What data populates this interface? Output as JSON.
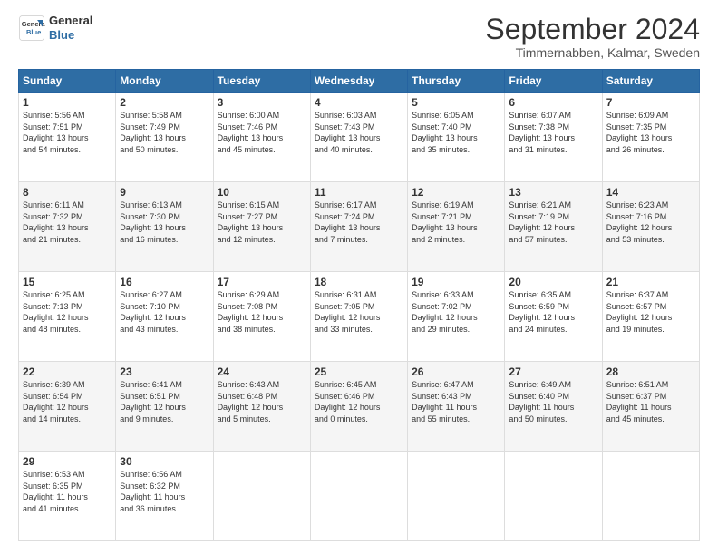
{
  "logo": {
    "line1": "General",
    "line2": "Blue"
  },
  "title": "September 2024",
  "subtitle": "Timmernabben, Kalmar, Sweden",
  "days_header": [
    "Sunday",
    "Monday",
    "Tuesday",
    "Wednesday",
    "Thursday",
    "Friday",
    "Saturday"
  ],
  "weeks": [
    [
      {
        "day": "1",
        "info": "Sunrise: 5:56 AM\nSunset: 7:51 PM\nDaylight: 13 hours\nand 54 minutes."
      },
      {
        "day": "2",
        "info": "Sunrise: 5:58 AM\nSunset: 7:49 PM\nDaylight: 13 hours\nand 50 minutes."
      },
      {
        "day": "3",
        "info": "Sunrise: 6:00 AM\nSunset: 7:46 PM\nDaylight: 13 hours\nand 45 minutes."
      },
      {
        "day": "4",
        "info": "Sunrise: 6:03 AM\nSunset: 7:43 PM\nDaylight: 13 hours\nand 40 minutes."
      },
      {
        "day": "5",
        "info": "Sunrise: 6:05 AM\nSunset: 7:40 PM\nDaylight: 13 hours\nand 35 minutes."
      },
      {
        "day": "6",
        "info": "Sunrise: 6:07 AM\nSunset: 7:38 PM\nDaylight: 13 hours\nand 31 minutes."
      },
      {
        "day": "7",
        "info": "Sunrise: 6:09 AM\nSunset: 7:35 PM\nDaylight: 13 hours\nand 26 minutes."
      }
    ],
    [
      {
        "day": "8",
        "info": "Sunrise: 6:11 AM\nSunset: 7:32 PM\nDaylight: 13 hours\nand 21 minutes."
      },
      {
        "day": "9",
        "info": "Sunrise: 6:13 AM\nSunset: 7:30 PM\nDaylight: 13 hours\nand 16 minutes."
      },
      {
        "day": "10",
        "info": "Sunrise: 6:15 AM\nSunset: 7:27 PM\nDaylight: 13 hours\nand 12 minutes."
      },
      {
        "day": "11",
        "info": "Sunrise: 6:17 AM\nSunset: 7:24 PM\nDaylight: 13 hours\nand 7 minutes."
      },
      {
        "day": "12",
        "info": "Sunrise: 6:19 AM\nSunset: 7:21 PM\nDaylight: 13 hours\nand 2 minutes."
      },
      {
        "day": "13",
        "info": "Sunrise: 6:21 AM\nSunset: 7:19 PM\nDaylight: 12 hours\nand 57 minutes."
      },
      {
        "day": "14",
        "info": "Sunrise: 6:23 AM\nSunset: 7:16 PM\nDaylight: 12 hours\nand 53 minutes."
      }
    ],
    [
      {
        "day": "15",
        "info": "Sunrise: 6:25 AM\nSunset: 7:13 PM\nDaylight: 12 hours\nand 48 minutes."
      },
      {
        "day": "16",
        "info": "Sunrise: 6:27 AM\nSunset: 7:10 PM\nDaylight: 12 hours\nand 43 minutes."
      },
      {
        "day": "17",
        "info": "Sunrise: 6:29 AM\nSunset: 7:08 PM\nDaylight: 12 hours\nand 38 minutes."
      },
      {
        "day": "18",
        "info": "Sunrise: 6:31 AM\nSunset: 7:05 PM\nDaylight: 12 hours\nand 33 minutes."
      },
      {
        "day": "19",
        "info": "Sunrise: 6:33 AM\nSunset: 7:02 PM\nDaylight: 12 hours\nand 29 minutes."
      },
      {
        "day": "20",
        "info": "Sunrise: 6:35 AM\nSunset: 6:59 PM\nDaylight: 12 hours\nand 24 minutes."
      },
      {
        "day": "21",
        "info": "Sunrise: 6:37 AM\nSunset: 6:57 PM\nDaylight: 12 hours\nand 19 minutes."
      }
    ],
    [
      {
        "day": "22",
        "info": "Sunrise: 6:39 AM\nSunset: 6:54 PM\nDaylight: 12 hours\nand 14 minutes."
      },
      {
        "day": "23",
        "info": "Sunrise: 6:41 AM\nSunset: 6:51 PM\nDaylight: 12 hours\nand 9 minutes."
      },
      {
        "day": "24",
        "info": "Sunrise: 6:43 AM\nSunset: 6:48 PM\nDaylight: 12 hours\nand 5 minutes."
      },
      {
        "day": "25",
        "info": "Sunrise: 6:45 AM\nSunset: 6:46 PM\nDaylight: 12 hours\nand 0 minutes."
      },
      {
        "day": "26",
        "info": "Sunrise: 6:47 AM\nSunset: 6:43 PM\nDaylight: 11 hours\nand 55 minutes."
      },
      {
        "day": "27",
        "info": "Sunrise: 6:49 AM\nSunset: 6:40 PM\nDaylight: 11 hours\nand 50 minutes."
      },
      {
        "day": "28",
        "info": "Sunrise: 6:51 AM\nSunset: 6:37 PM\nDaylight: 11 hours\nand 45 minutes."
      }
    ],
    [
      {
        "day": "29",
        "info": "Sunrise: 6:53 AM\nSunset: 6:35 PM\nDaylight: 11 hours\nand 41 minutes."
      },
      {
        "day": "30",
        "info": "Sunrise: 6:56 AM\nSunset: 6:32 PM\nDaylight: 11 hours\nand 36 minutes."
      },
      {
        "day": "",
        "info": ""
      },
      {
        "day": "",
        "info": ""
      },
      {
        "day": "",
        "info": ""
      },
      {
        "day": "",
        "info": ""
      },
      {
        "day": "",
        "info": ""
      }
    ]
  ]
}
